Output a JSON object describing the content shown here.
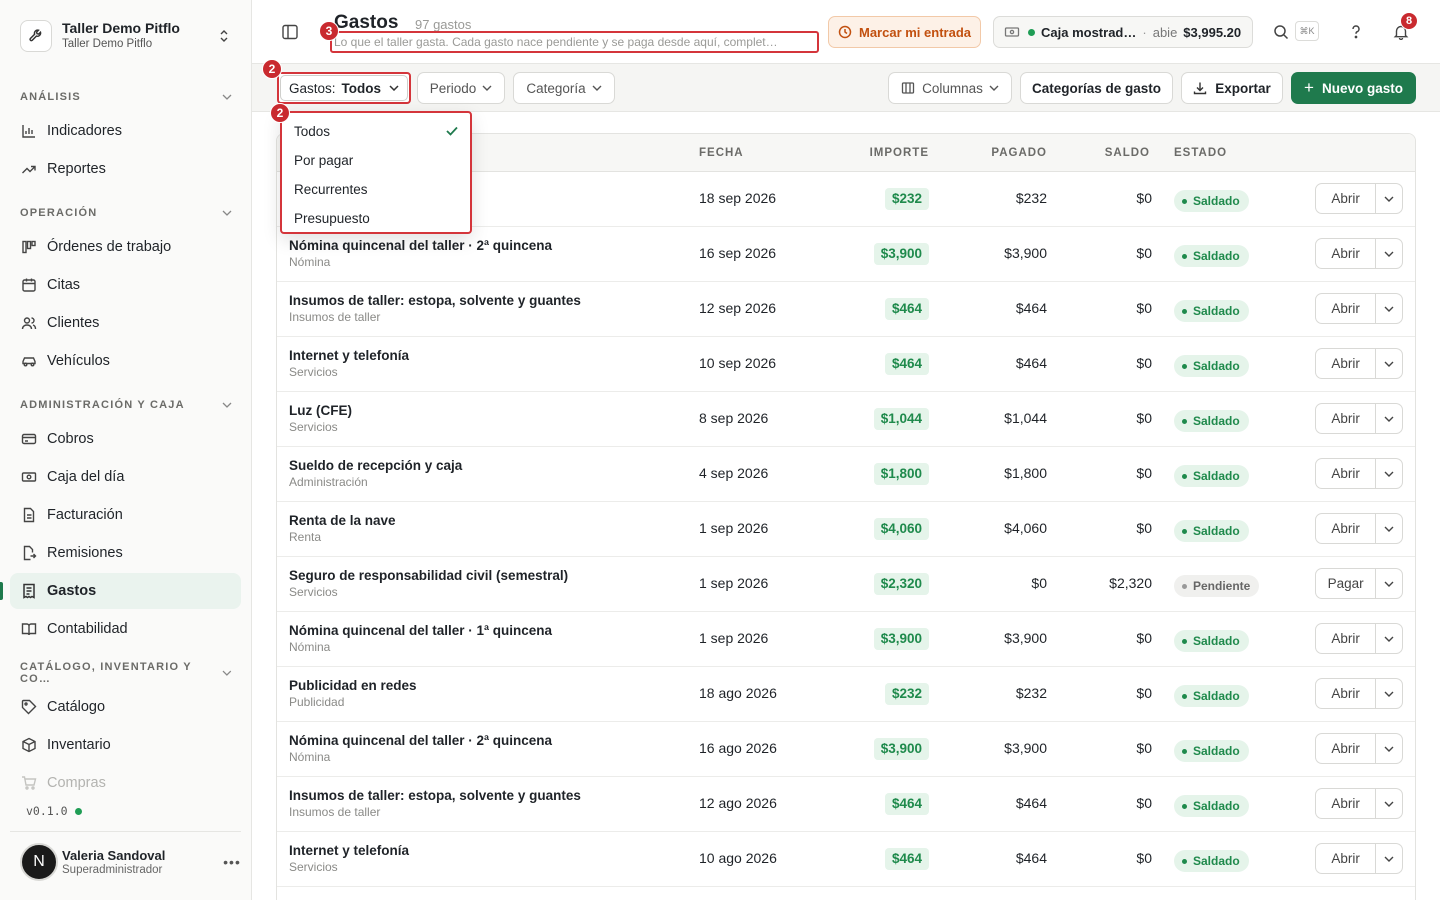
{
  "org": {
    "name": "Taller Demo Pitflo",
    "sub": "Taller Demo Pitflo"
  },
  "sidebar": {
    "sections": [
      {
        "title": "ANÁLISIS"
      },
      {
        "title": "OPERACIÓN"
      },
      {
        "title": "ADMINISTRACIÓN Y CAJA"
      },
      {
        "title": "CATÁLOGO, INVENTARIO Y CO…"
      }
    ],
    "items": [
      {
        "label": "Indicadores",
        "icon": "bar-chart-icon"
      },
      {
        "label": "Reportes",
        "icon": "trend-icon"
      },
      {
        "label": "Órdenes de trabajo",
        "icon": "kanban-icon"
      },
      {
        "label": "Citas",
        "icon": "calendar-icon"
      },
      {
        "label": "Clientes",
        "icon": "users-icon"
      },
      {
        "label": "Vehículos",
        "icon": "car-icon"
      },
      {
        "label": "Cobros",
        "icon": "credit-card-icon"
      },
      {
        "label": "Caja del día",
        "icon": "cash-icon"
      },
      {
        "label": "Facturación",
        "icon": "invoice-icon"
      },
      {
        "label": "Remisiones",
        "icon": "file-export-icon"
      },
      {
        "label": "Gastos",
        "icon": "receipt-icon"
      },
      {
        "label": "Contabilidad",
        "icon": "book-icon"
      },
      {
        "label": "Catálogo",
        "icon": "tag-icon"
      },
      {
        "label": "Inventario",
        "icon": "box-icon"
      },
      {
        "label": "Compras",
        "icon": "cart-icon"
      }
    ],
    "version": "v0.1.0"
  },
  "user": {
    "initial": "N",
    "name": "Valeria Sandoval",
    "role": "Superadministrador"
  },
  "header": {
    "title": "Gastos",
    "count": "97 gastos",
    "description": "Lo que el taller gasta. Cada gasto nace pendiente y se paga desde aquí, complet…",
    "entrada_label": "Marcar mi entrada",
    "caja": {
      "name": "Caja mostrad…",
      "sep": "·",
      "state": "abie",
      "amount": "$3,995.20"
    },
    "kbd": "⌘K",
    "notifications": "8",
    "annotation_desc": "3",
    "annotation_filter": "2",
    "annotation_menu": "2"
  },
  "filters": {
    "gastos_label": "Gastos:",
    "gastos_value": "Todos",
    "periodo": "Periodo",
    "categoria": "Categoría",
    "columnas": "Columnas",
    "categorias_gasto": "Categorías de gasto",
    "exportar": "Exportar",
    "nuevo": "Nuevo gasto"
  },
  "dropdown": {
    "options": [
      "Todos",
      "Por pagar",
      "Recurrentes",
      "Presupuesto"
    ],
    "selected": "Todos"
  },
  "table": {
    "headers": {
      "fecha": "FECHA",
      "importe": "IMPORTE",
      "pagado": "PAGADO",
      "saldo": "SALDO",
      "estado": "ESTADO"
    },
    "rows": [
      {
        "name": "",
        "category": "",
        "date": "18 sep 2026",
        "amount": "$232",
        "paid": "$232",
        "balance": "$0",
        "status": "Saldado",
        "action": "Abrir"
      },
      {
        "name": "Nómina quincenal del taller · 2ª quincena",
        "category": "Nómina",
        "date": "16 sep 2026",
        "amount": "$3,900",
        "paid": "$3,900",
        "balance": "$0",
        "status": "Saldado",
        "action": "Abrir"
      },
      {
        "name": "Insumos de taller: estopa, solvente y guantes",
        "category": "Insumos de taller",
        "date": "12 sep 2026",
        "amount": "$464",
        "paid": "$464",
        "balance": "$0",
        "status": "Saldado",
        "action": "Abrir"
      },
      {
        "name": "Internet y telefonía",
        "category": "Servicios",
        "date": "10 sep 2026",
        "amount": "$464",
        "paid": "$464",
        "balance": "$0",
        "status": "Saldado",
        "action": "Abrir"
      },
      {
        "name": "Luz (CFE)",
        "category": "Servicios",
        "date": "8 sep 2026",
        "amount": "$1,044",
        "paid": "$1,044",
        "balance": "$0",
        "status": "Saldado",
        "action": "Abrir"
      },
      {
        "name": "Sueldo de recepción y caja",
        "category": "Administración",
        "date": "4 sep 2026",
        "amount": "$1,800",
        "paid": "$1,800",
        "balance": "$0",
        "status": "Saldado",
        "action": "Abrir"
      },
      {
        "name": "Renta de la nave",
        "category": "Renta",
        "date": "1 sep 2026",
        "amount": "$4,060",
        "paid": "$4,060",
        "balance": "$0",
        "status": "Saldado",
        "action": "Abrir"
      },
      {
        "name": "Seguro de responsabilidad civil (semestral)",
        "category": "Servicios",
        "date": "1 sep 2026",
        "amount": "$2,320",
        "paid": "$0",
        "balance": "$2,320",
        "status": "Pendiente",
        "action": "Pagar"
      },
      {
        "name": "Nómina quincenal del taller · 1ª quincena",
        "category": "Nómina",
        "date": "1 sep 2026",
        "amount": "$3,900",
        "paid": "$3,900",
        "balance": "$0",
        "status": "Saldado",
        "action": "Abrir"
      },
      {
        "name": "Publicidad en redes",
        "category": "Publicidad",
        "date": "18 ago 2026",
        "amount": "$232",
        "paid": "$232",
        "balance": "$0",
        "status": "Saldado",
        "action": "Abrir"
      },
      {
        "name": "Nómina quincenal del taller · 2ª quincena",
        "category": "Nómina",
        "date": "16 ago 2026",
        "amount": "$3,900",
        "paid": "$3,900",
        "balance": "$0",
        "status": "Saldado",
        "action": "Abrir"
      },
      {
        "name": "Insumos de taller: estopa, solvente y guantes",
        "category": "Insumos de taller",
        "date": "12 ago 2026",
        "amount": "$464",
        "paid": "$464",
        "balance": "$0",
        "status": "Saldado",
        "action": "Abrir"
      },
      {
        "name": "Internet y telefonía",
        "category": "Servicios",
        "date": "10 ago 2026",
        "amount": "$464",
        "paid": "$464",
        "balance": "$0",
        "status": "Saldado",
        "action": "Abrir"
      }
    ]
  },
  "colors": {
    "accent": "#1f7a4d",
    "annotation": "#d4353b",
    "ok": "#1f8a4c",
    "warn": "#c2500f"
  }
}
